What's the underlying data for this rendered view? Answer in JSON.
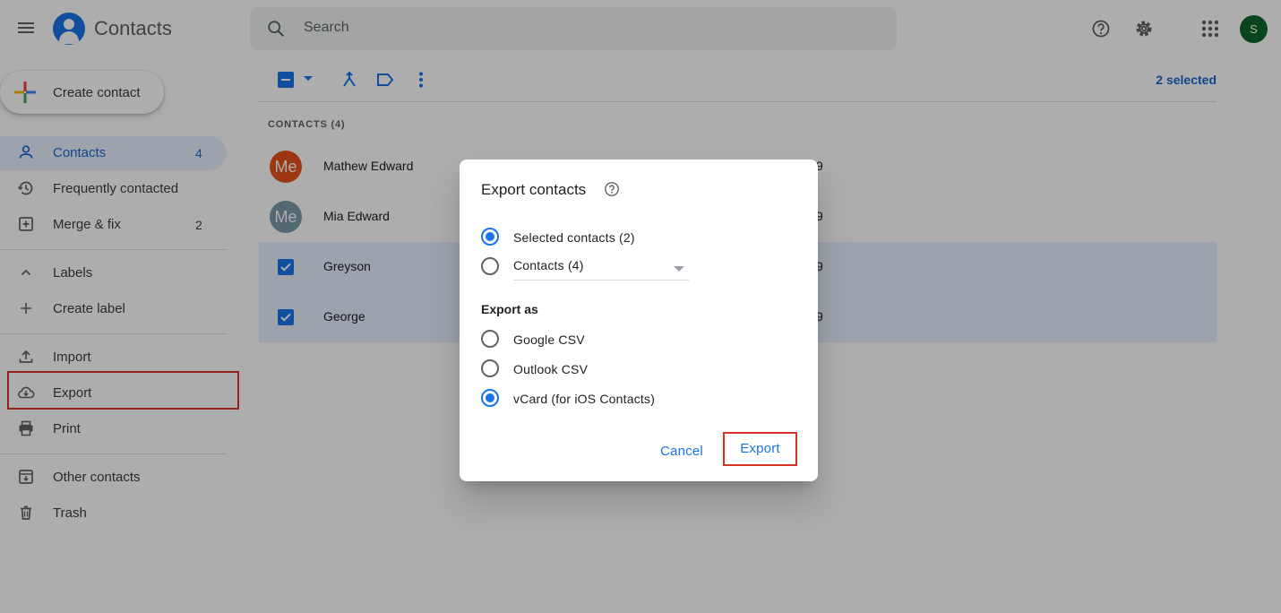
{
  "app": {
    "title": "Contacts",
    "search_placeholder": "Search",
    "account_initial": "S"
  },
  "sidebar": {
    "create_label": "Create contact",
    "items": [
      {
        "label": "Contacts",
        "count": "4"
      },
      {
        "label": "Frequently contacted",
        "count": ""
      },
      {
        "label": "Merge & fix",
        "count": "2"
      },
      {
        "label": "Labels",
        "count": ""
      },
      {
        "label": "Create label",
        "count": ""
      },
      {
        "label": "Import",
        "count": ""
      },
      {
        "label": "Export",
        "count": ""
      },
      {
        "label": "Print",
        "count": ""
      },
      {
        "label": "Other contacts",
        "count": ""
      },
      {
        "label": "Trash",
        "count": ""
      }
    ]
  },
  "toolbar": {
    "selected_count": "2 selected"
  },
  "list": {
    "header": "CONTACTS (4)",
    "rows": [
      {
        "name": "Mathew Edward",
        "avatar": "Me",
        "avatar_color": "#e8511a",
        "selected": false,
        "trail": "9"
      },
      {
        "name": "Mia Edward",
        "avatar": "Me",
        "avatar_color": "#7a9bac",
        "selected": false,
        "trail": "9"
      },
      {
        "name": "Greyson",
        "avatar": "",
        "selected": true,
        "trail": "9"
      },
      {
        "name": "George",
        "avatar": "",
        "selected": true,
        "trail": "9"
      }
    ]
  },
  "dialog": {
    "title": "Export contacts",
    "scope_options": [
      "Selected contacts (2)",
      "Contacts (4)"
    ],
    "scope_selected": "Selected contacts (2)",
    "export_as_label": "Export as",
    "format_options": [
      "Google CSV",
      "Outlook CSV",
      "vCard (for iOS Contacts)"
    ],
    "format_selected": "vCard (for iOS Contacts)",
    "cancel_label": "Cancel",
    "export_label": "Export"
  },
  "colors": {
    "accent": "#1a73e8",
    "highlight": "#d93025",
    "avatar_account": "#0d652d"
  }
}
